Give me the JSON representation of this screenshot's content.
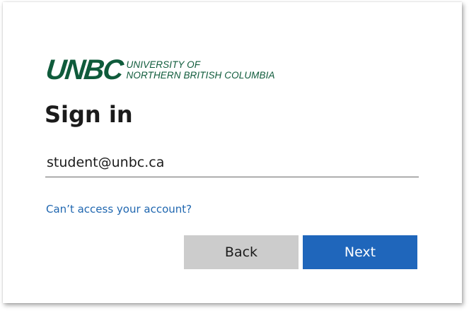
{
  "logo": {
    "mark": "UNBC",
    "line1": "UNIVERSITY OF",
    "line2": "NORTHERN BRITISH COLUMBIA"
  },
  "title": "Sign in",
  "email": {
    "value": "student@unbc.ca"
  },
  "links": {
    "cant_access": "Can’t access your account?"
  },
  "buttons": {
    "back": "Back",
    "next": "Next"
  },
  "colors": {
    "brand_green": "#0f5b3b",
    "link_blue": "#2067b0",
    "primary_button": "#1f66bb",
    "secondary_button": "#cccccc"
  }
}
